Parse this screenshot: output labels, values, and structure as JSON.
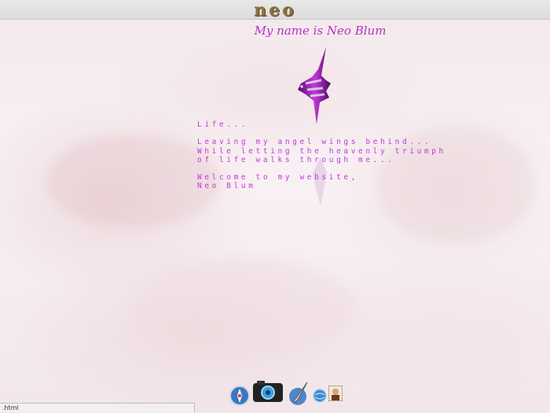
{
  "header": {
    "logo_text": "neo",
    "subtitle": "My name is Neo Blum"
  },
  "poem": {
    "lines": [
      "Life...",
      "",
      "Leaving my angel wings behind...",
      "While letting the heavenly triumph",
      "of life walks through me...",
      "",
      "Welcome to my website,",
      "Neo Blum"
    ]
  },
  "dock": {
    "items": [
      {
        "icon": "compass-globe-icon"
      },
      {
        "icon": "camera-icon"
      },
      {
        "icon": "paintbrush-icon"
      },
      {
        "icon": "globe-icon"
      },
      {
        "icon": "portrait-icon"
      }
    ]
  },
  "status": {
    "url_text": ".html"
  },
  "colors": {
    "accent": "#c03adc",
    "subtitle": "#b431c8",
    "logo": "#8a7240",
    "background": "#f6eef0"
  }
}
